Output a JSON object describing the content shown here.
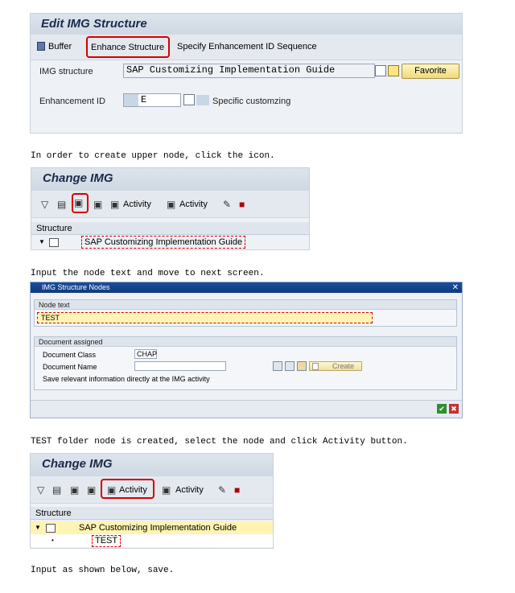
{
  "colors": {
    "accent_red": "#d40000",
    "sap_blue": "#1b2a4a",
    "input_yellow": "#fff4b3",
    "dialog_title": "#1c4f9e"
  },
  "shot1": {
    "title": "Edit IMG Structure",
    "toolbar": {
      "buffer": "Buffer",
      "enhance": "Enhance Structure",
      "specify": "Specify Enhancement ID Sequence"
    },
    "img_structure_label": "IMG structure",
    "img_structure_value": "SAP Customizing Implementation Guide",
    "favorite": "Favorite",
    "enhancement_id_label": "Enhancement ID",
    "enhancement_id_value": "E",
    "enhancement_desc": "Specific customzing"
  },
  "captions": {
    "c1": "In order to create upper node, click the icon.",
    "c2": "Input the node text and move to next screen.",
    "c3": "TEST folder node is created, select the node and click Activity button.",
    "c4": "Input as shown below, save."
  },
  "shot2": {
    "title": "Change IMG",
    "activity1": "Activity",
    "activity2": "Activity",
    "structure": "Structure",
    "root": "SAP Customizing Implementation Guide"
  },
  "shot3": {
    "title": "IMG Structure Nodes",
    "node_text_group": "Node text",
    "node_text_value": "TEST",
    "doc_group": "Document assigned",
    "doc_class_label": "Document Class",
    "doc_class_value": "CHAP",
    "doc_name_label": "Document Name",
    "create": "Create",
    "save_info": "Save relevant information directly at the IMG activity"
  },
  "shot4": {
    "title": "Change IMG",
    "activity1": "Activity",
    "activity2": "Activity",
    "structure": "Structure",
    "root": "SAP Customizing Implementation Guide",
    "child": "TEST"
  }
}
